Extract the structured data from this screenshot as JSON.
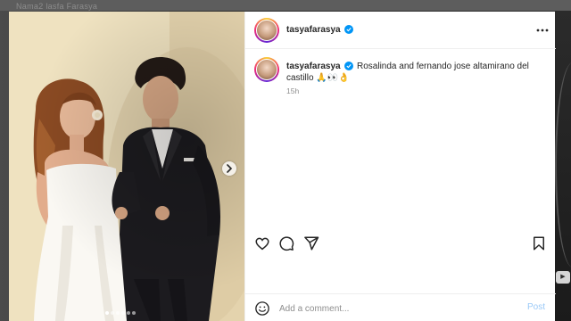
{
  "backdrop": {
    "ghost_text": "Nama2 lasfa Farasya"
  },
  "post": {
    "username": "tasyafarasya",
    "caption": {
      "username": "tasyafarasya",
      "text": "Rosalinda and fernando jose altamirano del castillo 🙏👀👌",
      "time": "15h"
    },
    "carousel": {
      "slide_count": 6,
      "active_index": 0
    }
  },
  "comment_box": {
    "placeholder": "Add a comment...",
    "post_label": "Post"
  },
  "icons": {
    "more": "more-horizontal-icon",
    "like": "heart-icon",
    "comment": "comment-bubble-icon",
    "share": "paper-plane-icon",
    "save": "bookmark-icon",
    "emoji": "smiley-icon",
    "next": "chevron-right-icon",
    "verified": "verified-badge-icon"
  },
  "colors": {
    "accent": "#0095f6",
    "post_button_disabled": "#9ac9f7",
    "text_primary": "#262626",
    "text_secondary": "#8e8e8e"
  }
}
